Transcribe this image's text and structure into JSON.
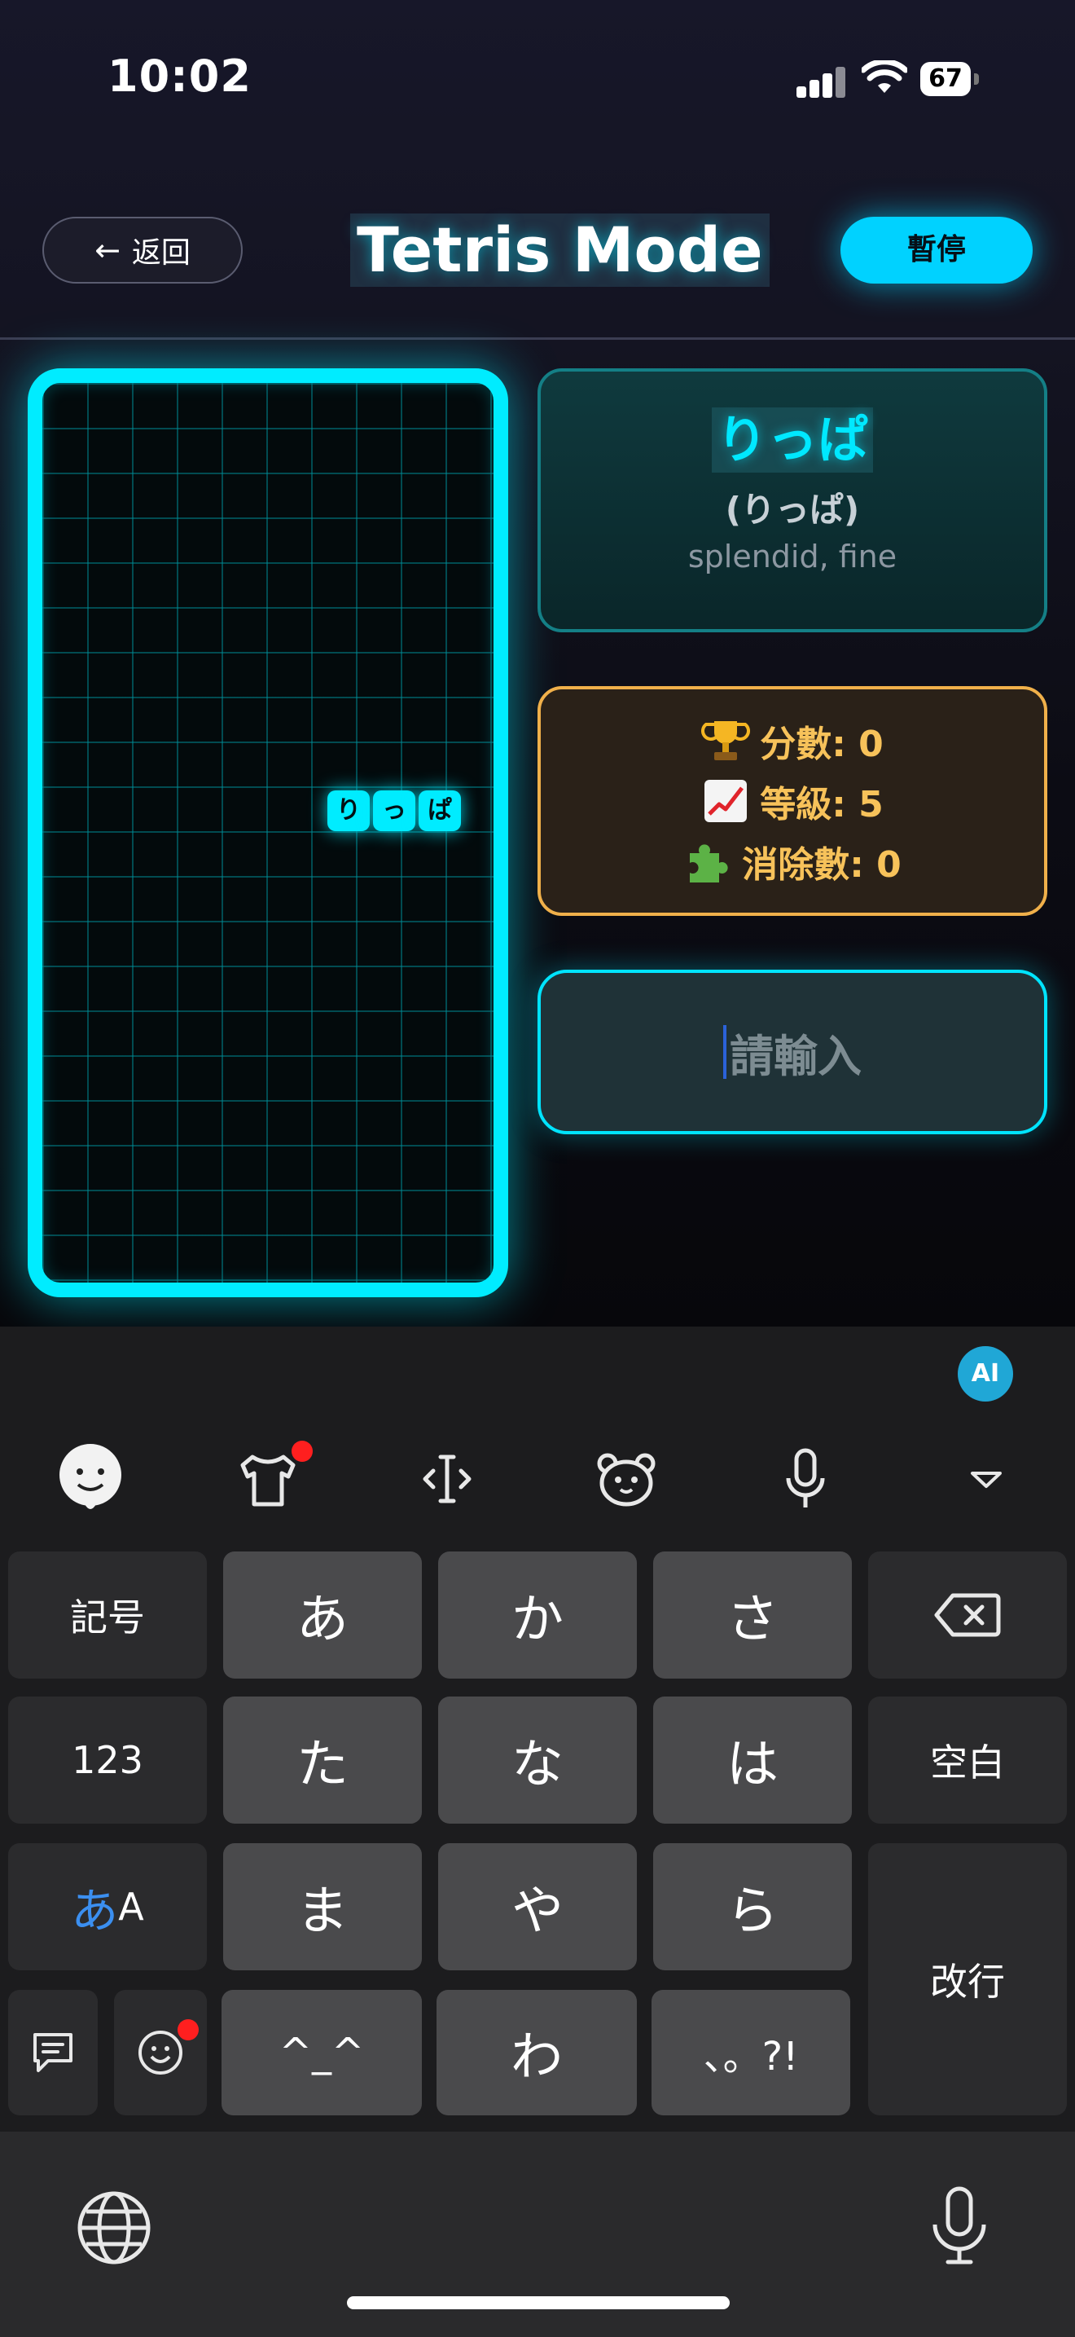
{
  "status_bar": {
    "time": "10:02",
    "battery": "67"
  },
  "header": {
    "back_label": "返回",
    "title": "Tetris Mode",
    "pause_label": "暫停"
  },
  "board": {
    "piece_blocks": [
      "り",
      "っ",
      "ぱ"
    ]
  },
  "word_card": {
    "word": "りっぱ",
    "reading": "(りっぱ)",
    "meaning": "splendid, fine"
  },
  "stats": {
    "score_label": "分數: 0",
    "level_label": "等級: 5",
    "lines_label": "消除數: 0",
    "icons": [
      "trophy-icon",
      "chart-up-icon",
      "puzzle-icon"
    ]
  },
  "answer_input": {
    "placeholder": "請輸入",
    "value": ""
  },
  "keyboard": {
    "ai_label": "AI",
    "toolbar_icons": [
      "face-sticker-icon",
      "shirt-icon",
      "cursor-move-icon",
      "bear-icon",
      "microphone-icon",
      "collapse-icon"
    ],
    "row1": {
      "left": "記号",
      "keys": [
        "あ",
        "か",
        "さ"
      ],
      "right_icon": "delete-icon"
    },
    "row2": {
      "left": "123",
      "keys": [
        "た",
        "な",
        "は"
      ],
      "right": "空白"
    },
    "row3": {
      "left_kana": "あ",
      "left_latin": "A",
      "keys": [
        "ま",
        "や",
        "ら"
      ],
      "right": "改行"
    },
    "row4": {
      "left_icons": [
        "comment-icon",
        "emoji-icon"
      ],
      "keys": [
        "^_^",
        "わ",
        "、。?!"
      ]
    },
    "bottom_icons": [
      "globe-icon",
      "dictation-microphone-icon"
    ]
  },
  "colors": {
    "accent": "#00e8ff",
    "stats_border": "#f0b04a",
    "stats_text": "#f7c25a",
    "pause_bg": "#00d2ff"
  }
}
